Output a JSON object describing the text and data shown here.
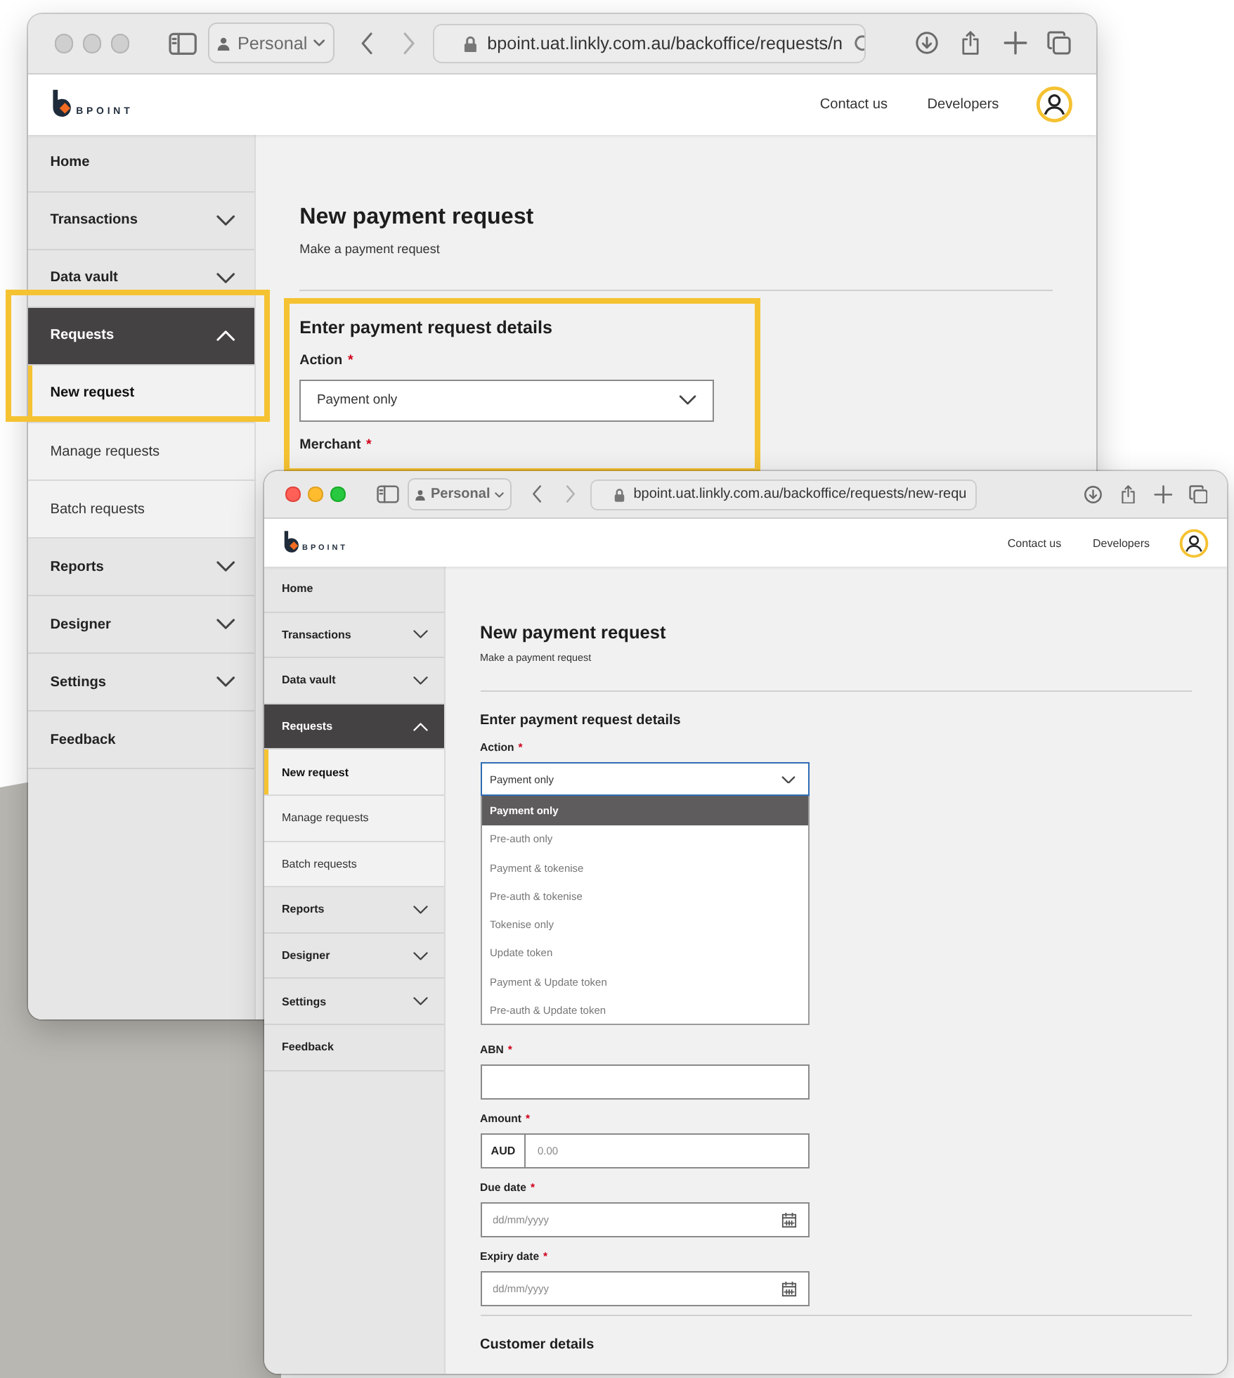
{
  "windows": [
    {
      "active": false,
      "toolbar": {
        "profile": "Personal",
        "url": "bpoint.uat.linkly.com.au/backoffice/requests/n"
      },
      "header": {
        "logo_text": "BPOINT",
        "links": [
          "Contact us",
          "Developers"
        ]
      },
      "sidebar": [
        {
          "kind": "link",
          "label": "Home",
          "highlighted": false
        },
        {
          "kind": "group",
          "label": "Transactions",
          "expanded": false,
          "highlighted": false
        },
        {
          "kind": "group",
          "label": "Data vault",
          "expanded": false,
          "highlighted": false
        },
        {
          "kind": "group",
          "label": "Requests",
          "expanded": true,
          "highlighted": true,
          "children": [
            {
              "label": "New request",
              "selected": true
            },
            {
              "label": "Manage requests",
              "selected": false
            },
            {
              "label": "Batch requests",
              "selected": false
            }
          ]
        },
        {
          "kind": "group",
          "label": "Reports",
          "expanded": false,
          "highlighted": false
        },
        {
          "kind": "group",
          "label": "Designer",
          "expanded": false,
          "highlighted": false
        },
        {
          "kind": "group",
          "label": "Settings",
          "expanded": false,
          "highlighted": false
        },
        {
          "kind": "link",
          "label": "Feedback",
          "highlighted": false
        }
      ],
      "page": {
        "highlighted": true,
        "title": "New payment request",
        "subtitle": "Make a payment request",
        "section": "Enter payment request details",
        "fields": [
          {
            "kind": "select",
            "label": "Action",
            "required_mark": "*",
            "value": "Payment only",
            "open": false
          },
          {
            "kind": "label",
            "label": "Merchant",
            "required_mark": "*"
          }
        ]
      }
    },
    {
      "active": true,
      "toolbar": {
        "profile": "Personal",
        "url": "bpoint.uat.linkly.com.au/backoffice/requests/new-requ"
      },
      "header": {
        "logo_text": "BPOINT",
        "links": [
          "Contact us",
          "Developers"
        ]
      },
      "sidebar": [
        {
          "kind": "link",
          "label": "Home"
        },
        {
          "kind": "group",
          "label": "Transactions",
          "expanded": false
        },
        {
          "kind": "group",
          "label": "Data vault",
          "expanded": false
        },
        {
          "kind": "group",
          "label": "Requests",
          "expanded": true,
          "children": [
            {
              "label": "New request",
              "selected": true
            },
            {
              "label": "Manage requests",
              "selected": false
            },
            {
              "label": "Batch requests",
              "selected": false
            }
          ]
        },
        {
          "kind": "group",
          "label": "Reports",
          "expanded": false
        },
        {
          "kind": "group",
          "label": "Designer",
          "expanded": false
        },
        {
          "kind": "group",
          "label": "Settings",
          "expanded": false
        },
        {
          "kind": "link",
          "label": "Feedback"
        }
      ],
      "page": {
        "title": "New payment request",
        "subtitle": "Make a payment request",
        "section": "Enter payment request details",
        "fields": [
          {
            "kind": "select",
            "label": "Action",
            "required_mark": "*",
            "value": "Payment only",
            "open": true,
            "options": [
              {
                "label": "Payment only",
                "selected": true
              },
              {
                "label": "Pre-auth only",
                "selected": false
              },
              {
                "label": "Payment & tokenise",
                "selected": false
              },
              {
                "label": "Pre-auth & tokenise",
                "selected": false
              },
              {
                "label": "Tokenise only",
                "selected": false
              },
              {
                "label": "Update token",
                "selected": false
              },
              {
                "label": "Payment & Update token",
                "selected": false
              },
              {
                "label": "Pre-auth & Update token",
                "selected": false
              }
            ]
          },
          {
            "kind": "text",
            "label": "ABN",
            "required_mark": "*"
          },
          {
            "kind": "amount",
            "label": "Amount",
            "required_mark": "*",
            "currency": "AUD",
            "placeholder": "0.00"
          },
          {
            "kind": "date",
            "label": "Due date",
            "required_mark": "*",
            "placeholder": "dd/mm/yyyy"
          },
          {
            "kind": "date",
            "label": "Expiry date",
            "required_mark": "*",
            "placeholder": "dd/mm/yyyy"
          }
        ],
        "next_section": "Customer details"
      }
    }
  ]
}
